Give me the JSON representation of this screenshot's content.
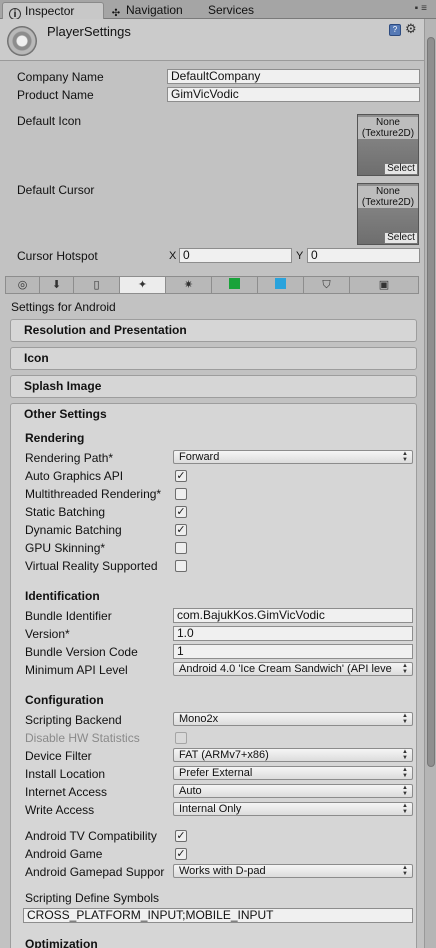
{
  "tabs": [
    {
      "label": "Inspector",
      "icon": "info-icon"
    },
    {
      "label": "Navigation",
      "icon": "navigation-icon"
    },
    {
      "label": "Services",
      "icon": ""
    }
  ],
  "header": {
    "title": "PlayerSettings",
    "icons": [
      "help-book-icon",
      "settings-gear-icon"
    ]
  },
  "general": {
    "company_name_label": "Company Name",
    "company_name": "DefaultCompany",
    "product_name_label": "Product Name",
    "product_name": "GimVicVodic",
    "default_icon_label": "Default Icon",
    "default_cursor_label": "Default Cursor",
    "texture_none": "None",
    "texture_type": "(Texture2D)",
    "select_label": "Select",
    "cursor_hotspot_label": "Cursor Hotspot",
    "hotspot_x_label": "X",
    "hotspot_x": "0",
    "hotspot_y_label": "Y",
    "hotspot_y": "0"
  },
  "platform_tabs": [
    "globe-icon",
    "download-icon",
    "phone-icon",
    "android-icon",
    "unity-icon",
    "windows-store-icon",
    "windows-phone-icon",
    "html5-icon",
    "cube-icon"
  ],
  "settings_for": "Settings for Android",
  "panels": {
    "resolution": "Resolution and Presentation",
    "icon": "Icon",
    "splash": "Splash Image",
    "other": "Other Settings"
  },
  "rendering": {
    "title": "Rendering",
    "rendering_path_label": "Rendering Path*",
    "rendering_path": "Forward",
    "auto_graphics_label": "Auto Graphics API",
    "auto_graphics": true,
    "multithreaded_label": "Multithreaded Rendering*",
    "multithreaded": false,
    "static_batching_label": "Static Batching",
    "static_batching": true,
    "dynamic_batching_label": "Dynamic Batching",
    "dynamic_batching": true,
    "gpu_skinning_label": "GPU Skinning*",
    "gpu_skinning": false,
    "vr_label": "Virtual Reality Supported",
    "vr": false
  },
  "identification": {
    "title": "Identification",
    "bundle_id_label": "Bundle Identifier",
    "bundle_id": "com.BajukKos.GimVicVodic",
    "version_label": "Version*",
    "version": "1.0",
    "bundle_code_label": "Bundle Version Code",
    "bundle_code": "1",
    "min_api_label": "Minimum API Level",
    "min_api": "Android 4.0 'Ice Cream Sandwich' (API leve"
  },
  "configuration": {
    "title": "Configuration",
    "scripting_backend_label": "Scripting Backend",
    "scripting_backend": "Mono2x",
    "disable_hw_label": "Disable HW Statistics",
    "device_filter_label": "Device Filter",
    "device_filter": "FAT (ARMv7+x86)",
    "install_location_label": "Install Location",
    "install_location": "Prefer External",
    "internet_access_label": "Internet Access",
    "internet_access": "Auto",
    "write_access_label": "Write Access",
    "write_access": "Internal Only",
    "tv_compat_label": "Android TV Compatibility",
    "tv_compat": true,
    "android_game_label": "Android Game",
    "android_game": true,
    "gamepad_label": "Android Gamepad Suppor",
    "gamepad": "Works with D-pad",
    "define_symbols_label": "Scripting Define Symbols",
    "define_symbols": "CROSS_PLATFORM_INPUT;MOBILE_INPUT"
  },
  "optimization": {
    "title": "Optimization"
  }
}
